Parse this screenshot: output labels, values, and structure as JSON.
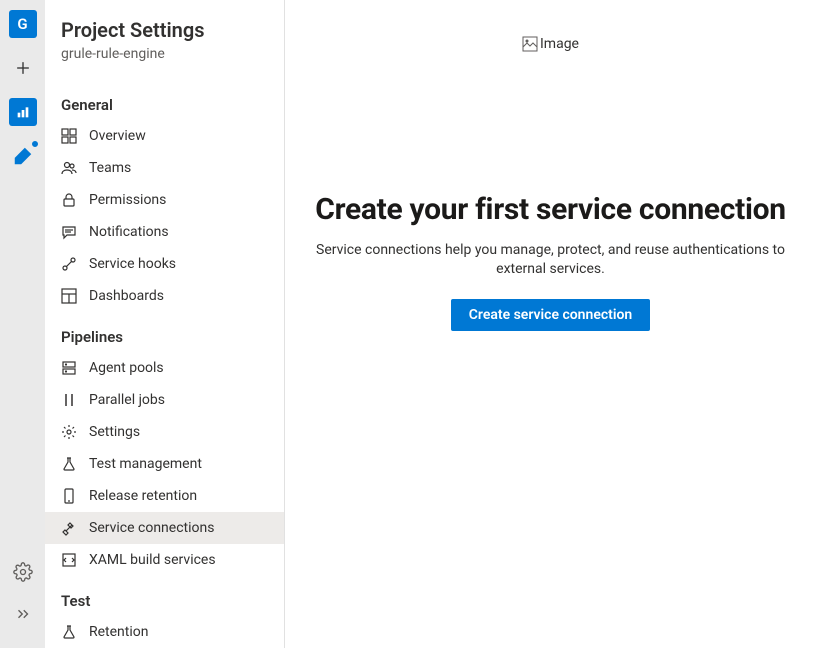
{
  "rail": {
    "project_initial": "G"
  },
  "sidebar": {
    "title": "Project Settings",
    "subtitle": "grule-rule-engine",
    "sections": [
      {
        "header": "General",
        "items": [
          {
            "label": "Overview"
          },
          {
            "label": "Teams"
          },
          {
            "label": "Permissions"
          },
          {
            "label": "Notifications"
          },
          {
            "label": "Service hooks"
          },
          {
            "label": "Dashboards"
          }
        ]
      },
      {
        "header": "Pipelines",
        "items": [
          {
            "label": "Agent pools"
          },
          {
            "label": "Parallel jobs"
          },
          {
            "label": "Settings"
          },
          {
            "label": "Test management"
          },
          {
            "label": "Release retention"
          },
          {
            "label": "Service connections"
          },
          {
            "label": "XAML build services"
          }
        ]
      },
      {
        "header": "Test",
        "items": [
          {
            "label": "Retention"
          }
        ]
      }
    ]
  },
  "main": {
    "image_alt": "Image",
    "title": "Create your first service connection",
    "description": "Service connections help you manage, protect, and reuse authentications to external services.",
    "button_label": "Create service connection"
  }
}
